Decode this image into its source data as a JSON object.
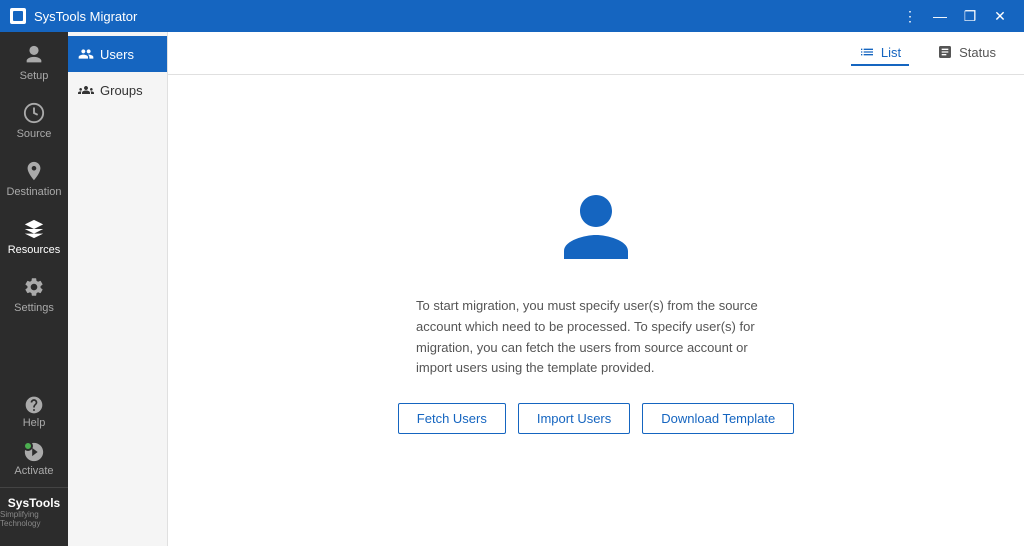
{
  "titleBar": {
    "title": "SysTools Migrator",
    "controls": {
      "menu": "⋮",
      "minimize": "—",
      "restore": "❐",
      "close": "✕"
    }
  },
  "sidebar": {
    "items": [
      {
        "id": "setup",
        "label": "Setup"
      },
      {
        "id": "source",
        "label": "Source"
      },
      {
        "id": "destination",
        "label": "Destination"
      },
      {
        "id": "resources",
        "label": "Resources",
        "active": true
      },
      {
        "id": "settings",
        "label": "Settings"
      }
    ],
    "help_label": "Help",
    "activate_label": "Activate",
    "logo_text": "SysTools",
    "logo_sub": "Simplifying Technology"
  },
  "subSidebar": {
    "items": [
      {
        "id": "users",
        "label": "Users",
        "active": true
      },
      {
        "id": "groups",
        "label": "Groups"
      }
    ]
  },
  "topBar": {
    "tabs": [
      {
        "id": "list",
        "label": "List",
        "active": true
      },
      {
        "id": "status",
        "label": "Status"
      }
    ]
  },
  "emptyState": {
    "description": "To start migration, you must specify user(s) from the source account which need to be processed. To specify user(s) for migration, you can fetch the users from source account or import users using the template provided.",
    "buttons": [
      {
        "id": "fetch-users",
        "label": "Fetch Users"
      },
      {
        "id": "import-users",
        "label": "Import Users"
      },
      {
        "id": "download-template",
        "label": "Download Template"
      }
    ]
  }
}
